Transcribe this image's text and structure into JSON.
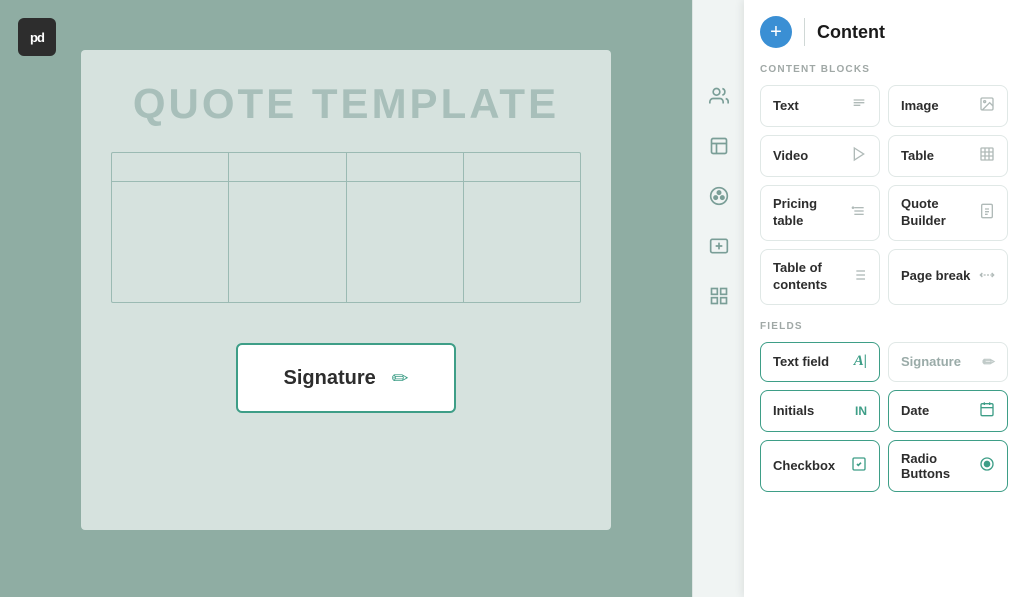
{
  "logo": {
    "text": "pd"
  },
  "document": {
    "title": "QUOTE TEMPLATE",
    "signature_label": "Signature"
  },
  "sidebar": {
    "icons": [
      {
        "name": "users-icon",
        "glyph": "👥"
      },
      {
        "name": "embed-icon",
        "glyph": "⬛"
      },
      {
        "name": "palette-icon",
        "glyph": "🎨"
      },
      {
        "name": "pricing-icon",
        "glyph": "💲"
      },
      {
        "name": "grid-icon",
        "glyph": "⋮⋮"
      }
    ]
  },
  "panel": {
    "plus_label": "+",
    "title": "Content",
    "content_blocks_label": "CONTENT BLOCKS",
    "fields_label": "FIELDS",
    "blocks": [
      {
        "id": "text",
        "label": "Text",
        "icon": "T≡"
      },
      {
        "id": "image",
        "label": "Image",
        "icon": "▣"
      },
      {
        "id": "video",
        "label": "Video",
        "icon": "▶"
      },
      {
        "id": "table",
        "label": "Table",
        "icon": "⊞"
      },
      {
        "id": "pricing-table",
        "label": "Pricing table",
        "icon": "$≡"
      },
      {
        "id": "quote-builder",
        "label": "Quote Builder",
        "icon": "🛍"
      },
      {
        "id": "table-of-contents",
        "label": "Table of contents",
        "icon": "≡≡"
      },
      {
        "id": "page-break",
        "label": "Page break",
        "icon": "✂"
      }
    ],
    "fields": [
      {
        "id": "text-field",
        "label": "Text field",
        "icon": "A|",
        "active": true
      },
      {
        "id": "signature",
        "label": "Signature",
        "icon": "✏",
        "active": false
      },
      {
        "id": "initials",
        "label": "Initials",
        "icon": "IN",
        "active": true
      },
      {
        "id": "date",
        "label": "Date",
        "icon": "📅",
        "active": true
      },
      {
        "id": "checkbox",
        "label": "Checkbox",
        "icon": "☑",
        "active": true
      },
      {
        "id": "radio-buttons",
        "label": "Radio Buttons",
        "icon": "◎",
        "active": true
      }
    ]
  }
}
